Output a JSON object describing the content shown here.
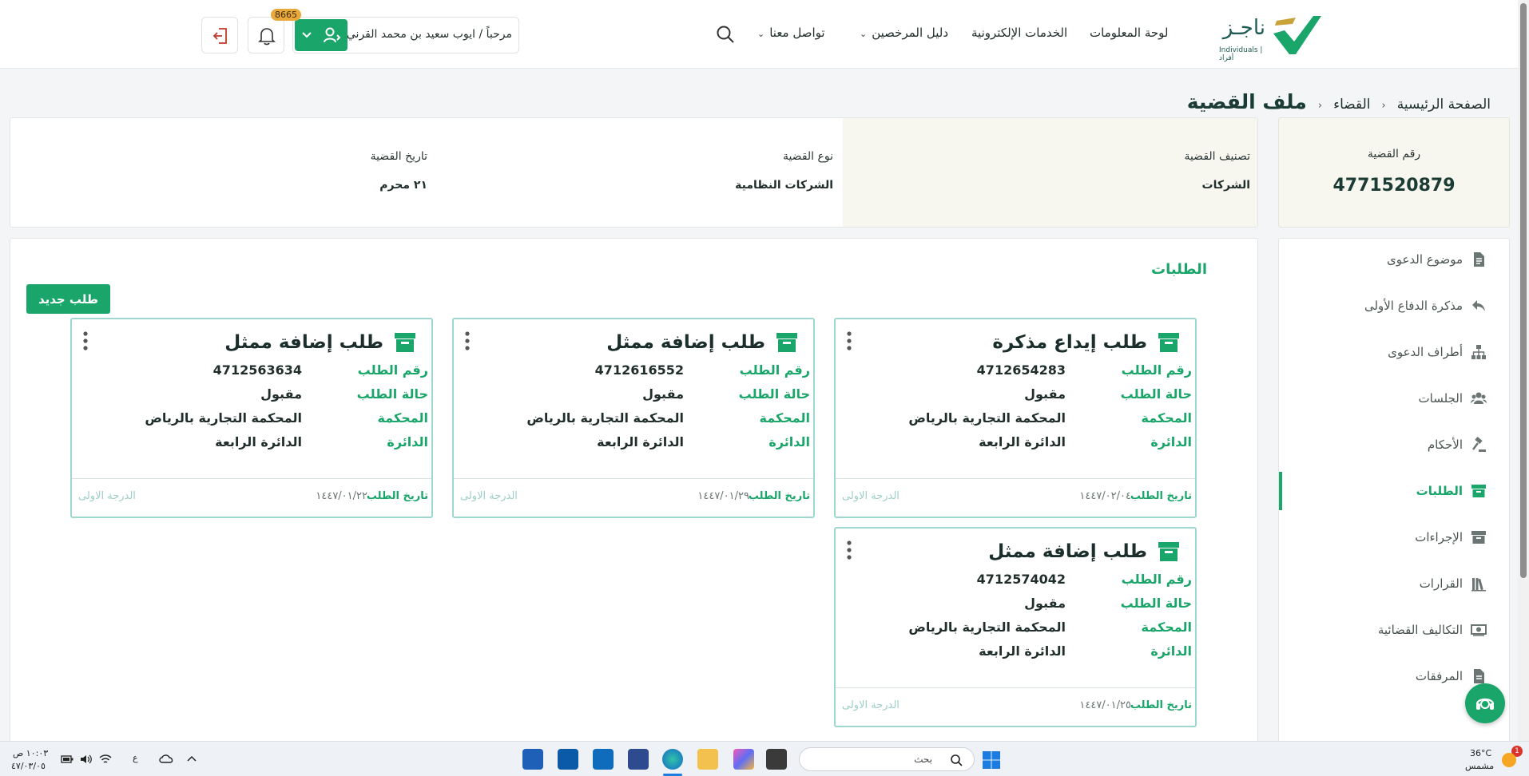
{
  "header": {
    "logo_text": "ناجـز",
    "logo_sub": "Individuals | أفراد",
    "nav": {
      "dashboard": "لوحة المعلومات",
      "eservices": "الخدمات الإلكترونية",
      "licensees": "دليل المرخصين",
      "contact": "تواصل معنا"
    },
    "user_greeting": "مرحباً / ايوب سعيد بن محمد القرني",
    "notification_count": "8665"
  },
  "breadcrumb": {
    "home": "الصفحة الرئيسية",
    "judiciary": "القضاء",
    "current": "ملف القضية"
  },
  "case": {
    "number_label": "رقم القضية",
    "number": "4771520879",
    "classification_label": "تصنيف القضية",
    "classification": "الشركات",
    "type_label": "نوع القضية",
    "type": "الشركات النظامية",
    "date_label": "تاريخ القضية",
    "date": "٢١ محرم"
  },
  "sidebar": {
    "items": [
      {
        "label": "موضوع الدعوى",
        "icon": "document-icon"
      },
      {
        "label": "مذكرة الدفاع الأولى",
        "icon": "reply-icon"
      },
      {
        "label": "أطراف الدعوى",
        "icon": "org-chart-icon"
      },
      {
        "label": "الجلسات",
        "icon": "users-icon"
      },
      {
        "label": "الأحكام",
        "icon": "gavel-icon"
      },
      {
        "label": "الطلبات",
        "icon": "archive-icon"
      },
      {
        "label": "الإجراءات",
        "icon": "archive-icon"
      },
      {
        "label": "القرارات",
        "icon": "books-icon"
      },
      {
        "label": "التكاليف القضائية",
        "icon": "money-icon"
      },
      {
        "label": "المرفقات",
        "icon": "file-icon"
      }
    ],
    "active_index": 5
  },
  "requests": {
    "section_title": "الطلبات",
    "new_button": "طلب جديد",
    "labels": {
      "number": "رقم الطلب",
      "status": "حالة الطلب",
      "court": "المحكمة",
      "circuit": "الدائرة",
      "date": "تاريخ الطلب"
    },
    "cards": [
      {
        "title": "طلب إيداع مذكرة",
        "number": "4712654283",
        "status": "مقبول",
        "court": "المحكمة التجارية بالرياض",
        "circuit": "الدائرة الرابعة",
        "date": "١٤٤٧/٠٢/٠٤",
        "degree": "الدرجة الاولى"
      },
      {
        "title": "طلب إضافة ممثل",
        "number": "4712616552",
        "status": "مقبول",
        "court": "المحكمة التجارية بالرياض",
        "circuit": "الدائرة الرابعة",
        "date": "١٤٤٧/٠١/٢٩",
        "degree": "الدرجة الاولى"
      },
      {
        "title": "طلب إضافة ممثل",
        "number": "4712563634",
        "status": "مقبول",
        "court": "المحكمة التجارية بالرياض",
        "circuit": "الدائرة الرابعة",
        "date": "١٤٤٧/٠١/٢٢",
        "degree": "الدرجة الاولى"
      },
      {
        "title": "طلب إضافة ممثل",
        "number": "4712574042",
        "status": "مقبول",
        "court": "المحكمة التجارية بالرياض",
        "circuit": "الدائرة الرابعة",
        "date": "١٤٤٧/٠١/٢٥",
        "degree": "الدرجة الاولى"
      }
    ]
  },
  "taskbar": {
    "weather_temp": "36°C",
    "weather_desc": "مشمس",
    "weather_badge": "1",
    "search_placeholder": "بحث",
    "time": "١٠:٠٣ ص",
    "date": "٤٧/٠٣/٠٥",
    "lang": "ع"
  },
  "colors": {
    "accent": "#1aa56a",
    "card_border": "#9fd6cf",
    "badge": "#e8a83a"
  }
}
